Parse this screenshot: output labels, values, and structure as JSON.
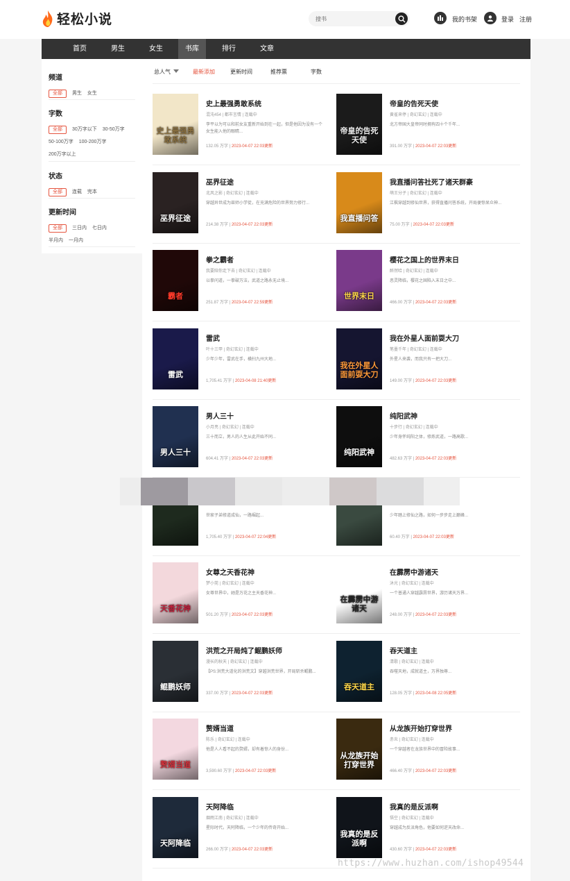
{
  "header": {
    "logo_text": "轻松小说",
    "search_placeholder": "搜书",
    "bookshelf_label": "我的书架",
    "login_label": "登录",
    "register_label": "注册"
  },
  "nav": {
    "items": [
      {
        "label": "首页"
      },
      {
        "label": "男生"
      },
      {
        "label": "女生"
      },
      {
        "label": "书库"
      },
      {
        "label": "排行"
      },
      {
        "label": "文章"
      }
    ],
    "active": "书库"
  },
  "filters": {
    "channel": {
      "title": "频道",
      "options": [
        "全部",
        "男生",
        "女生"
      ],
      "selected": "全部"
    },
    "wordcount": {
      "title": "字数",
      "options": [
        "全部",
        "30万字以下",
        "30-50万字",
        "50-100万字",
        "100-200万字",
        "200万字以上"
      ],
      "selected": "全部"
    },
    "status": {
      "title": "状态",
      "options": [
        "全部",
        "连载",
        "完本"
      ],
      "selected": "全部"
    },
    "updated": {
      "title": "更新时间",
      "options": [
        "全部",
        "三日内",
        "七日内",
        "半月内",
        "一月内"
      ],
      "selected": "全部"
    }
  },
  "sort": {
    "options": [
      "总人气",
      "最新添加",
      "更新时间",
      "推荐票",
      "字数"
    ],
    "active": "最新添加"
  },
  "books": [
    {
      "title": "史上最强勇敢系统",
      "meta": "混沌454 | 都市言情 | 连载中",
      "desc": "李平以为可以和前女友重新开始到在一起，但是他因为没有一个女生能入他的眼睛...",
      "words": "132.05 万字",
      "date": "2023-04-07 22:03更新",
      "cover_text": "史上最强勇敢系统",
      "cover_bg": "#f2e6c8",
      "cover_fg": "#8a7040"
    },
    {
      "title": "帝皇的告死天使",
      "meta": "黄雀来停 | 奇幻玄幻 | 连载中",
      "desc": "北方帝国大皇帝同时拥有四十个千年...",
      "words": "391.00 万字",
      "date": "2023-04-07 22:03更新",
      "cover_text": "帝皇的告死天使",
      "cover_bg": "#1b1b1b",
      "cover_fg": "#eeeeee"
    },
    {
      "title": "巫界征途",
      "meta": "北风之影 | 奇幻玄幻 | 连载中",
      "desc": "穿越异世成为巫师小学徒，在充满危险的世界努力修行...",
      "words": "214.38 万字",
      "date": "2023-04-07 22:03更新",
      "cover_text": "巫界征途",
      "cover_bg": "#2a2222",
      "cover_fg": "#ffffff"
    },
    {
      "title": "我直播问答社死了诸天群豪",
      "meta": "萌王分子 | 奇幻玄幻 | 连载中",
      "desc": "江枫穿越到修仙世界，获得直播问答系统，开局便惊呆众神...",
      "words": "75.00 万字",
      "date": "2023-04-07 22:03更新",
      "cover_text": "我直播问答",
      "cover_bg": "#d88a1a",
      "cover_fg": "#ffffff"
    },
    {
      "title": "拳之霸者",
      "meta": "我要陪你走下去 | 奇幻玄幻 | 连载中",
      "desc": "以拳问道，一拳破万法，武道之路永无止境...",
      "words": "251.87 万字",
      "date": "2023-04-07 22:59更新",
      "cover_text": "霸者",
      "cover_bg": "#200808",
      "cover_fg": "#ff3a2a"
    },
    {
      "title": "樱花之国上的世界末日",
      "meta": "醉然哈 | 奇幻玄幻 | 连载中",
      "desc": "恶灵降临，樱花之国陷入末日之中...",
      "words": "466.00 万字",
      "date": "2023-04-07 22:03更新",
      "cover_text": "世界末日",
      "cover_bg": "#7a3a8a",
      "cover_fg": "#ffd84a"
    },
    {
      "title": "雷武",
      "meta": "叶十三甲 | 奇幻玄幻 | 连载中",
      "desc": "少年少年，雷武在手，横扫九州大地...",
      "words": "1,705.41 万字",
      "date": "2023-04-08 21:40更新",
      "cover_text": "雷武",
      "cover_bg": "#1a1a4a",
      "cover_fg": "#ffffff"
    },
    {
      "title": "我在外星人面前耍大刀",
      "meta": "笔墨千年 | 奇幻玄幻 | 连载中",
      "desc": "外星人来袭，而我只有一把大刀...",
      "words": "149.00 万字",
      "date": "2023-04-07 22:03更新",
      "cover_text": "我在外星人面前耍大刀",
      "cover_bg": "#151530",
      "cover_fg": "#ff9a3a"
    },
    {
      "title": "男人三十",
      "meta": "小月亮 | 奇幻玄幻 | 连载中",
      "desc": "三十而立，男人的人生从此开始不同...",
      "words": "604.41 万字",
      "date": "2023-04-07 22:03更新",
      "cover_text": "男人三十",
      "cover_bg": "#203050",
      "cover_fg": "#ffffff"
    },
    {
      "title": "纯阳武神",
      "meta": "十步行 | 奇幻玄幻 | 连载中",
      "desc": "少年身怀纯阳之体，修炼武道，一路高歌...",
      "words": "482.63 万字",
      "date": "2023-04-07 22:03更新",
      "cover_text": "纯阳武神",
      "cover_bg": "#0e0e0e",
      "cover_fg": "#ffffff"
    },
    {
      "title": "",
      "meta": "",
      "desc": "世家子弟修道成仙，一路崛起...",
      "words": "1,705.40 万字",
      "date": "2023-04-07 22:04更新",
      "cover_text": "",
      "cover_bg": "#1e2a1e",
      "cover_fg": "#ffffff"
    },
    {
      "title": "",
      "meta": "",
      "desc": "少年踏上修仙之路，如何一步步走上巅峰...",
      "words": "60.40 万字",
      "date": "2023-04-07 22:03更新",
      "cover_text": "",
      "cover_bg": "#3a4a40",
      "cover_fg": "#ffffff"
    },
    {
      "title": "女尊之天香花神",
      "meta": "梦小莞 | 奇幻玄幻 | 连载中",
      "desc": "女尊世界中，她是万花之主天香花神...",
      "words": "501.20 万字",
      "date": "2023-04-07 22:03更新",
      "cover_text": "天香花神",
      "cover_bg": "#f3d8dc",
      "cover_fg": "#c0203a"
    },
    {
      "title": "在霹雳中游诸天",
      "meta": "沐光 | 奇幻玄幻 | 连载中",
      "desc": "一个普通人穿越霹雳世界，游历诸天万界...",
      "words": "248.00 万字",
      "date": "2023-04-07 22:03更新",
      "cover_text": "在霹雳中游诸天",
      "cover_bg": "#ffffff",
      "cover_fg": "#222222"
    },
    {
      "title": "洪荒之开局炖了鲲鹏妖师",
      "meta": "漫长的秋天 | 奇幻玄幻 | 连载中",
      "desc": "【PS:洪荒大道化的洪荒文】穿越洪荒世界，开局斩杀鲲鹏...",
      "words": "337.00 万字",
      "date": "2023-04-07 22:03更新",
      "cover_text": "鲲鹏妖师",
      "cover_bg": "#2a2f35",
      "cover_fg": "#ffffff"
    },
    {
      "title": "吞天道主",
      "meta": "清歌 | 奇幻玄幻 | 连载中",
      "desc": "吞噬天地，成就道主，万界独尊...",
      "words": "128.05 万字",
      "date": "2023-04-08 22:05更新",
      "cover_text": "吞天道主",
      "cover_bg": "#0e2230",
      "cover_fg": "#ffd84a"
    },
    {
      "title": "赘婿当道",
      "meta": "陈乐 | 奇幻玄幻 | 连载中",
      "desc": "他是人人看不起的赘婿，却有着惊人的身份...",
      "words": "3,590.60 万字",
      "date": "2023-04-07 22:03更新",
      "cover_text": "赘婿当道",
      "cover_bg": "#f3d8e0",
      "cover_fg": "#d0303a"
    },
    {
      "title": "从龙族开始打穿世界",
      "meta": "赤炎 | 奇幻玄幻 | 连载中",
      "desc": "一个穿越者在龙族世界中的冒险故事...",
      "words": "466.40 万字",
      "date": "2023-04-07 22:03更新",
      "cover_text": "从龙族开始打穿世界",
      "cover_bg": "#3a2a10",
      "cover_fg": "#ffffff"
    },
    {
      "title": "天阿降临",
      "meta": "烟雨江南 | 奇幻玄幻 | 连载中",
      "desc": "星际时代，天阿降临，一个少年的传奇开始...",
      "words": "266.00 万字",
      "date": "2023-04-07 22:03更新",
      "cover_text": "天阿降临",
      "cover_bg": "#1e2a3a",
      "cover_fg": "#ffffff"
    },
    {
      "title": "我真的是反派啊",
      "meta": "悟空 | 奇幻玄幻 | 连载中",
      "desc": "穿越成为反派角色，他要如何逆天改命...",
      "words": "430.60 万字",
      "date": "2023-04-07 22:03更新",
      "cover_text": "我真的是反派啊",
      "cover_bg": "#10141a",
      "cover_fg": "#ffffff"
    }
  ],
  "watermark": "https://www.huzhan.com/ishop49544"
}
